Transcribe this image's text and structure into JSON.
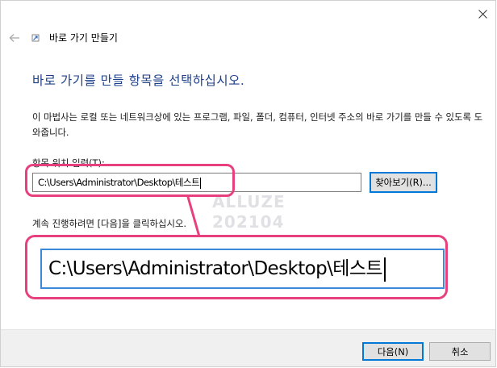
{
  "wizard": {
    "title": "바로 가기 만들기",
    "heading": "바로 가기를 만들 항목을 선택하십시오.",
    "description": "이 마법사는 로컬 또는 네트워크상에 있는 프로그램, 파일, 폴더, 컴퓨터, 인터넷 주소의 바로 가기를 만들 수 있도록 도와줍니다.",
    "field_label": "항목 위치 입력(T):",
    "location_value": "C:\\Users\\Administrator\\Desktop\\테스트",
    "browse_label": "찾아보기(R)...",
    "continue_text": "계속 진행하려면 [다음]을 클릭하십시오."
  },
  "callout": {
    "zoomed_value": "C:\\Users\\Administrator\\Desktop\\테스트"
  },
  "watermark": {
    "line1": "ALLUZE",
    "line2": "202104"
  },
  "footer": {
    "next_label": "다음(N)",
    "cancel_label": "취소"
  },
  "icons": {
    "close": "close-icon",
    "back": "back-arrow-icon",
    "app": "shortcut-icon"
  },
  "colors": {
    "heading": "#1e3f8a",
    "highlight": "#e8407f",
    "focus": "#0078d7"
  }
}
